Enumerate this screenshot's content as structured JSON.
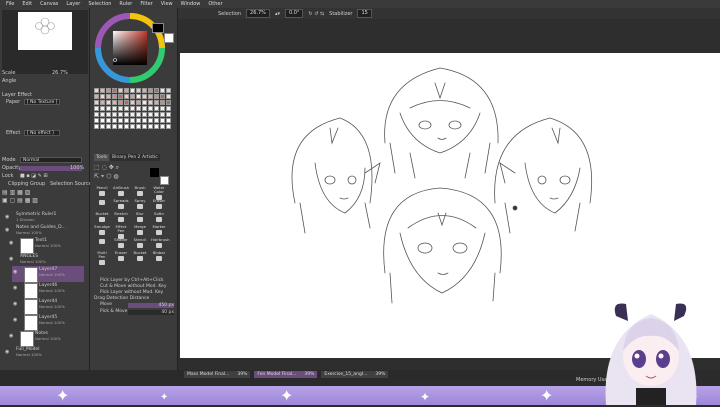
{
  "menu": [
    "File",
    "Edit",
    "Canvas",
    "Layer",
    "Selection",
    "Ruler",
    "Filter",
    "View",
    "Window",
    "Other"
  ],
  "toolbar": {
    "selection_label": "Selection",
    "zoom": "26.7%",
    "angle": "0.0°",
    "stabilizer_label": "Stabilizer",
    "stabilizer_value": "15"
  },
  "navigator": {
    "scale_label": "Scale",
    "scale_value": "26.7%",
    "angle_label": "Angle"
  },
  "layer_effect": {
    "title": "Layer Effect",
    "paper_label": "Paper",
    "paper_value": "[ No Texture ]",
    "effect_label": "Effect",
    "effect_value": "[ No effect ]"
  },
  "layer_props": {
    "mode_label": "Mode",
    "mode_value": "Normal",
    "opacity_label": "Opacity",
    "opacity_value": "100%",
    "lock_label": "Lock",
    "clipping_label": "Clipping Group",
    "selection_source": "Selection Source"
  },
  "layers": [
    {
      "name": "Symmetric Ruler1",
      "sub": "1 Division",
      "indent": 0,
      "thumb": false
    },
    {
      "name": "Notes and Guides_D...",
      "sub": "Normal 100%",
      "indent": 0,
      "thumb": false
    },
    {
      "name": "Text1",
      "sub": "Normal 100%",
      "indent": 1,
      "thumb": true
    },
    {
      "name": "ANGLES",
      "sub": "Normal 100%",
      "indent": 1,
      "thumb": false
    },
    {
      "name": "Layer47",
      "sub": "Normal 100%",
      "indent": 2,
      "thumb": true,
      "selected": true
    },
    {
      "name": "Layer46",
      "sub": "Normal 100%",
      "indent": 2,
      "thumb": true
    },
    {
      "name": "Layer44",
      "sub": "Normal 100%",
      "indent": 2,
      "thumb": true
    },
    {
      "name": "Layer45",
      "sub": "Normal 100%",
      "indent": 2,
      "thumb": true
    },
    {
      "name": "Notes",
      "sub": "Normal 100%",
      "indent": 1,
      "thumb": true
    },
    {
      "name": "Full_Model",
      "sub": "Normal 100%",
      "indent": 0,
      "thumb": false
    }
  ],
  "tool_tabs": [
    "Tools",
    "Binary",
    "Pen 2",
    "Artistic"
  ],
  "tools": [
    {
      "label": "Pencil"
    },
    {
      "label": "AirBrush"
    },
    {
      "label": "Brush"
    },
    {
      "label": "Water Color"
    },
    {
      "label": ""
    },
    {
      "label": "Spreads"
    },
    {
      "label": "Spray"
    },
    {
      "label": "Eraser"
    },
    {
      "label": "Bucket"
    },
    {
      "label": "Stretch"
    },
    {
      "label": "Blur"
    },
    {
      "label": "Softn"
    },
    {
      "label": "Smudge"
    },
    {
      "label": "Effect Pen"
    },
    {
      "label": "Merge"
    },
    {
      "label": "Marker"
    },
    {
      "label": ""
    },
    {
      "label": "Shader"
    },
    {
      "label": "Stencil"
    },
    {
      "label": "Hairbrush"
    },
    {
      "label": "Multi Pen"
    },
    {
      "label": "Eraser"
    },
    {
      "label": "Bucket"
    },
    {
      "label": "Binbar"
    }
  ],
  "tool_options": {
    "line1": "Pick Layer by Ctrl+Alt+Click",
    "line2": "Cut & Move without Mod. Key",
    "line3": "Pick Layer without Mod. Key",
    "drag_label": "Drag Detection Distance",
    "move_label": "Move",
    "move_value": "450 px",
    "pick_move_label": "Pick & Move",
    "pick_move_value": "40 px"
  },
  "doc_tabs": [
    {
      "label": "Mass Model Final...",
      "zoom": "39%",
      "active": false
    },
    {
      "label": "Fen Model Final...",
      "zoom": "39%",
      "active": true
    },
    {
      "label": "Exercise_15_angl...",
      "zoom": "39%",
      "active": false
    }
  ],
  "status": {
    "memory_label": "Memory Usage"
  },
  "colors": {
    "accent": "#6a4d7a",
    "canvas": "#ffffff",
    "banner": "#a893de"
  }
}
